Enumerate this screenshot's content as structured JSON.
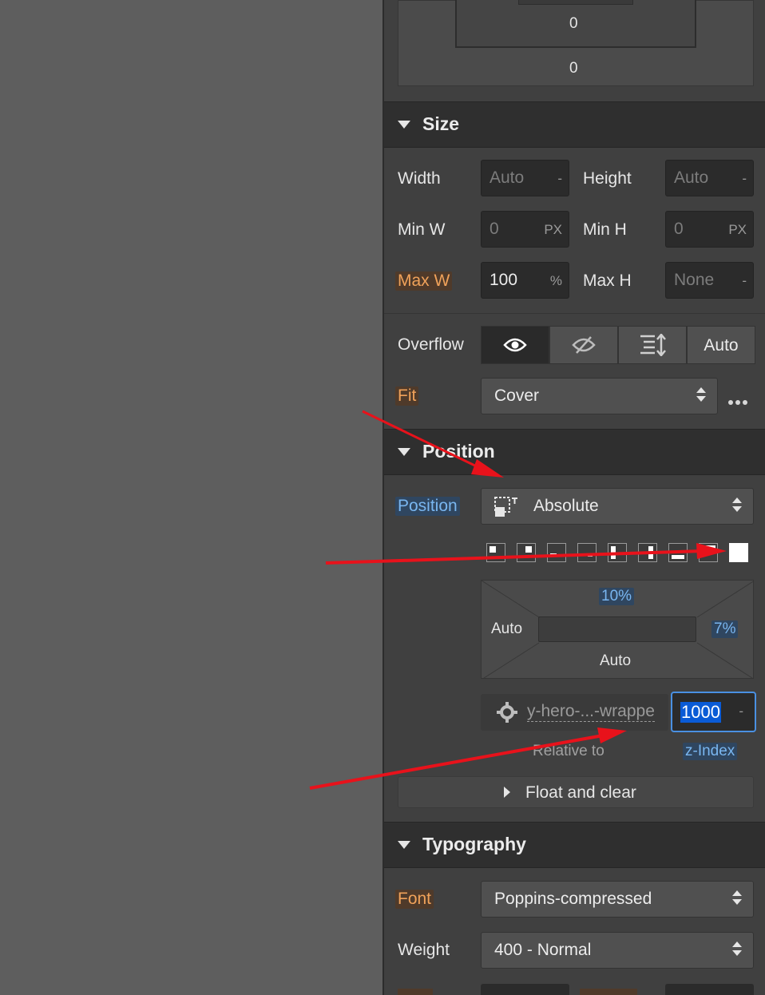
{
  "spacing": {
    "margin_inner_value": "0",
    "margin_outer_value": "0"
  },
  "size": {
    "section_title": "Size",
    "width_label": "Width",
    "width_value": "Auto",
    "width_unit": "-",
    "height_label": "Height",
    "height_value": "Auto",
    "height_unit": "-",
    "min_w_label": "Min W",
    "min_w_value": "0",
    "min_w_unit": "PX",
    "min_h_label": "Min H",
    "min_h_value": "0",
    "min_h_unit": "PX",
    "max_w_label": "Max W",
    "max_w_value": "100",
    "max_w_unit": "%",
    "max_h_label": "Max H",
    "max_h_value": "None",
    "max_h_unit": "-",
    "overflow_label": "Overflow",
    "overflow_auto": "Auto",
    "fit_label": "Fit",
    "fit_value": "Cover"
  },
  "position": {
    "section_title": "Position",
    "position_label": "Position",
    "position_value": "Absolute",
    "top_value": "10%",
    "right_value": "7%",
    "left_value": "Auto",
    "bottom_value": "Auto",
    "relative_to_value": "y-hero-...-wrappe",
    "relative_to_label": "Relative to",
    "z_index_value": "1000",
    "z_index_unit": "-",
    "z_index_label": "z-Index",
    "float_and_clear": "Float and clear"
  },
  "typography": {
    "section_title": "Typography",
    "font_label": "Font",
    "font_value": "Poppins-compressed",
    "weight_label": "Weight",
    "weight_value": "400 - Normal"
  },
  "colors": {
    "canvas": "#5e5e5e",
    "panel": "#404040",
    "header": "#2f2f2f",
    "orange_label": "#f0a25a",
    "blue_label": "#79b6f0",
    "selection": "#0a5bd6",
    "arrow": "#e8121b"
  }
}
